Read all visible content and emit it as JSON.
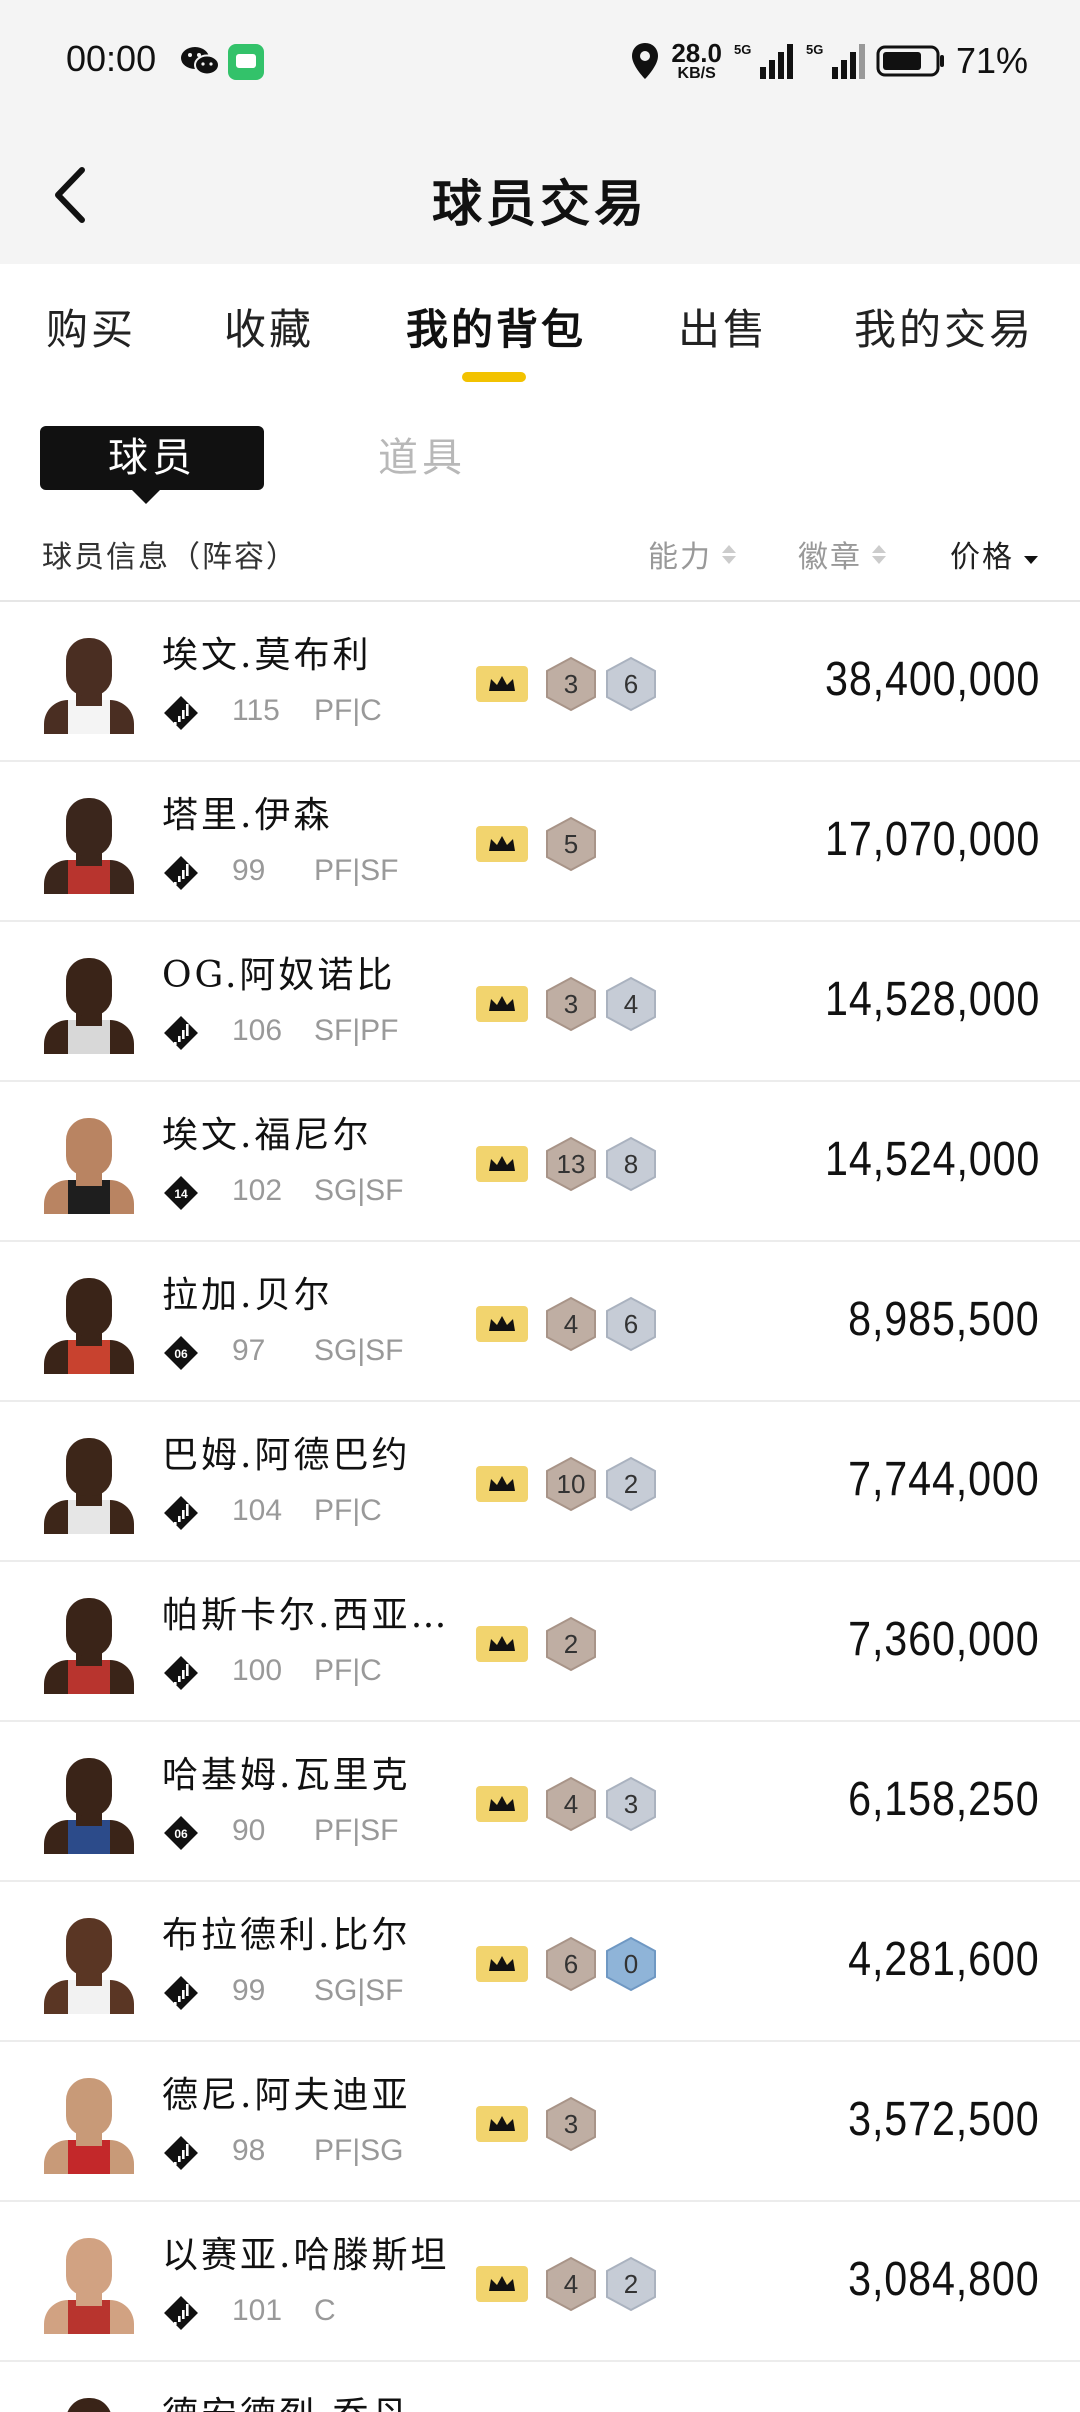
{
  "status_bar": {
    "time": "00:00",
    "speed_value": "28.0",
    "speed_unit": "KB/S",
    "battery": "71%",
    "icons": [
      "wechat-icon",
      "message-icon",
      "location-icon",
      "5g-signal-icon",
      "5g-signal-icon",
      "battery-icon"
    ]
  },
  "header": {
    "title": "球员交易",
    "back_icon": "chevron-left-icon"
  },
  "tabs": [
    {
      "label": "购买",
      "active": false
    },
    {
      "label": "收藏",
      "active": false
    },
    {
      "label": "我的背包",
      "active": true
    },
    {
      "label": "出售",
      "active": false
    },
    {
      "label": "我的交易",
      "active": false
    }
  ],
  "subtabs": {
    "players": "球员",
    "items": "道具"
  },
  "columns": {
    "info": "球员信息（阵容）",
    "ability": "能力",
    "badges": "徽章",
    "price": "价格"
  },
  "colors": {
    "accent": "#f2c200",
    "crown": "#f2d46e",
    "hex_bronze": "#bfaea3",
    "hex_silver": "#c6ccd6",
    "hex_blue": "#8fb4d8"
  },
  "players": [
    {
      "name": "埃文.莫布利",
      "tier": "signal",
      "rating": "115",
      "position": "PF|C",
      "badges": [
        "3",
        "6"
      ],
      "badge_types": [
        "bronze",
        "silver"
      ],
      "price": "38,400,000",
      "skin": "#4a2e22",
      "jersey": "#f4f4f4"
    },
    {
      "name": "塔里.伊森",
      "tier": "signal",
      "rating": "99",
      "position": "PF|SF",
      "badges": [
        "5"
      ],
      "badge_types": [
        "bronze"
      ],
      "price": "17,070,000",
      "skin": "#3b261c",
      "jersey": "#b8342e"
    },
    {
      "name": "OG.阿奴诺比",
      "tier": "signal",
      "rating": "106",
      "position": "SF|PF",
      "badges": [
        "3",
        "4"
      ],
      "badge_types": [
        "bronze",
        "silver"
      ],
      "price": "14,528,000",
      "skin": "#3a2418",
      "jersey": "#d8d8d8"
    },
    {
      "name": "埃文.福尼尔",
      "tier": "14",
      "rating": "102",
      "position": "SG|SF",
      "badges": [
        "13",
        "8"
      ],
      "badge_types": [
        "bronze",
        "silver"
      ],
      "price": "14,524,000",
      "skin": "#b98462",
      "jersey": "#1e1e1e"
    },
    {
      "name": "拉加.贝尔",
      "tier": "06",
      "rating": "97",
      "position": "SG|SF",
      "badges": [
        "4",
        "6"
      ],
      "badge_types": [
        "bronze",
        "silver"
      ],
      "price": "8,985,500",
      "skin": "#3a2418",
      "jersey": "#c8422f"
    },
    {
      "name": "巴姆.阿德巴约",
      "tier": "signal",
      "rating": "104",
      "position": "PF|C",
      "badges": [
        "10",
        "2"
      ],
      "badge_types": [
        "bronze",
        "silver"
      ],
      "price": "7,744,000",
      "skin": "#3d2619",
      "jersey": "#e6e6e6"
    },
    {
      "name": "帕斯卡尔.西亚卡姆",
      "tier": "signal",
      "rating": "100",
      "position": "PF|C",
      "badges": [
        "2"
      ],
      "badge_types": [
        "bronze"
      ],
      "price": "7,360,000",
      "skin": "#3a2418",
      "jersey": "#b8342e"
    },
    {
      "name": "哈基姆.瓦里克",
      "tier": "06",
      "rating": "90",
      "position": "PF|SF",
      "badges": [
        "4",
        "3"
      ],
      "badge_types": [
        "bronze",
        "silver"
      ],
      "price": "6,158,250",
      "skin": "#3a2418",
      "jersey": "#2c4b8a"
    },
    {
      "name": "布拉德利.比尔",
      "tier": "signal",
      "rating": "99",
      "position": "SG|SF",
      "badges": [
        "6",
        "0"
      ],
      "badge_types": [
        "bronze",
        "blue"
      ],
      "price": "4,281,600",
      "skin": "#5a3624",
      "jersey": "#f2f2f2"
    },
    {
      "name": "德尼.阿夫迪亚",
      "tier": "signal",
      "rating": "98",
      "position": "PF|SG",
      "badges": [
        "3"
      ],
      "badge_types": [
        "bronze"
      ],
      "price": "3,572,500",
      "skin": "#c89a78",
      "jersey": "#c3282a"
    },
    {
      "name": "以赛亚.哈滕斯坦",
      "tier": "signal",
      "rating": "101",
      "position": "C",
      "badges": [
        "4",
        "2"
      ],
      "badge_types": [
        "bronze",
        "silver"
      ],
      "price": "3,084,800",
      "skin": "#d1a282",
      "jersey": "#b8342e"
    },
    {
      "name": "德安德烈.乔丹",
      "tier": "signal",
      "rating": "",
      "position": "",
      "badges": [],
      "badge_types": [],
      "price": "",
      "skin": "#3a2418",
      "jersey": "#ffffff"
    }
  ]
}
